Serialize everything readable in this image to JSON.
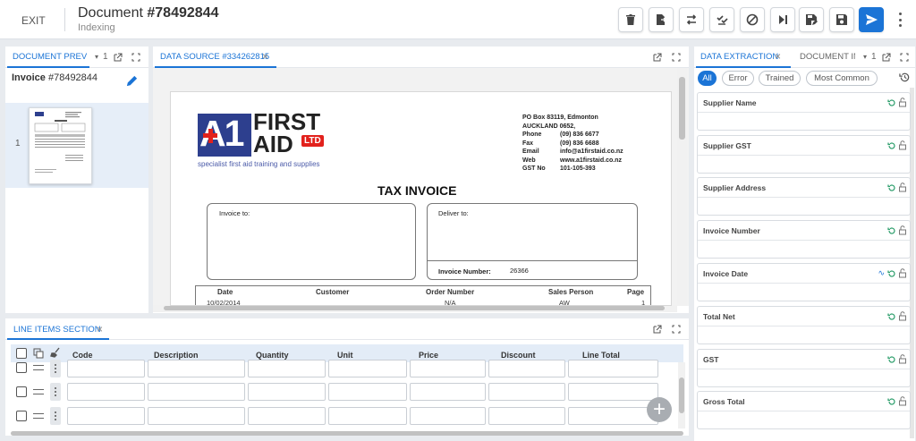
{
  "header": {
    "exit_label": "EXIT",
    "doc_label": "Document",
    "doc_number": "#78492844",
    "status": "Indexing"
  },
  "toolbar": [
    {
      "name": "delete-button",
      "icon": "trash-icon"
    },
    {
      "name": "split-document-button",
      "icon": "split-icon"
    },
    {
      "name": "swap-button",
      "icon": "swap-icon"
    },
    {
      "name": "validate-button",
      "icon": "check-seal-icon"
    },
    {
      "name": "reject-button",
      "icon": "block-icon"
    },
    {
      "name": "skip-next-button",
      "icon": "skip-next-icon"
    },
    {
      "name": "save-as-button",
      "icon": "save-edit-icon"
    },
    {
      "name": "save-button",
      "icon": "save-icon"
    },
    {
      "name": "submit-button",
      "icon": "send-icon"
    }
  ],
  "preview": {
    "tab_label": "DOCUMENT PREVIEW",
    "tab_count": "1",
    "invoice_label": "Invoice",
    "invoice_number": "#78492844",
    "page_number": "1"
  },
  "source": {
    "tab_label": "DATA SOURCE #334262815",
    "company_line1": "FIRST",
    "company_line2": "AID",
    "company_ltd": "LTD",
    "logo_mark": "A1",
    "tagline": "specialist first aid training and supplies",
    "address": [
      "PO Box 83119, Edmonton",
      "AUCKLAND 0652,"
    ],
    "contacts": [
      {
        "k": "Phone",
        "v": "(09) 836 6677"
      },
      {
        "k": "Fax",
        "v": "(09) 836 6688"
      },
      {
        "k": "Email",
        "v": "info@a1firstaid.co.nz"
      },
      {
        "k": "Web",
        "v": "www.a1firstaid.co.nz"
      },
      {
        "k": "GST No",
        "v": "101-105-393"
      }
    ],
    "title": "TAX INVOICE",
    "invoice_to": "Invoice to:",
    "deliver_to": "Deliver to:",
    "invoice_number_label": "Invoice Number:",
    "invoice_number_value": "26366",
    "table_headers": [
      "Date",
      "Customer",
      "Order Number",
      "Sales Person",
      "Page"
    ],
    "table_values": [
      "10/02/2014",
      "",
      "N/A",
      "AW",
      "1"
    ]
  },
  "extraction": {
    "tab_label": "DATA EXTRACTION",
    "tab2_label": "DOCUMENT INFO",
    "tab2_count": "1",
    "filters": [
      "All",
      "Error",
      "Trained",
      "Most Common"
    ],
    "active_filter": "All",
    "fields": [
      {
        "label": "Supplier Name",
        "value": ""
      },
      {
        "label": "Supplier GST",
        "value": ""
      },
      {
        "label": "Supplier Address",
        "value": ""
      },
      {
        "label": "Invoice Number",
        "value": ""
      },
      {
        "label": "Invoice Date",
        "value": ""
      },
      {
        "label": "Total Net",
        "value": ""
      },
      {
        "label": "GST",
        "value": ""
      },
      {
        "label": "Gross Total",
        "value": ""
      }
    ]
  },
  "lineitems": {
    "tab_label": "LINE ITEMS SECTION",
    "columns": [
      "Code",
      "Description",
      "Quantity",
      "Unit",
      "Price",
      "Discount",
      "Line Total"
    ]
  },
  "colors": {
    "accent": "#1b74d6",
    "logo_blue": "#2d3f8e",
    "logo_red": "#e2211c"
  }
}
